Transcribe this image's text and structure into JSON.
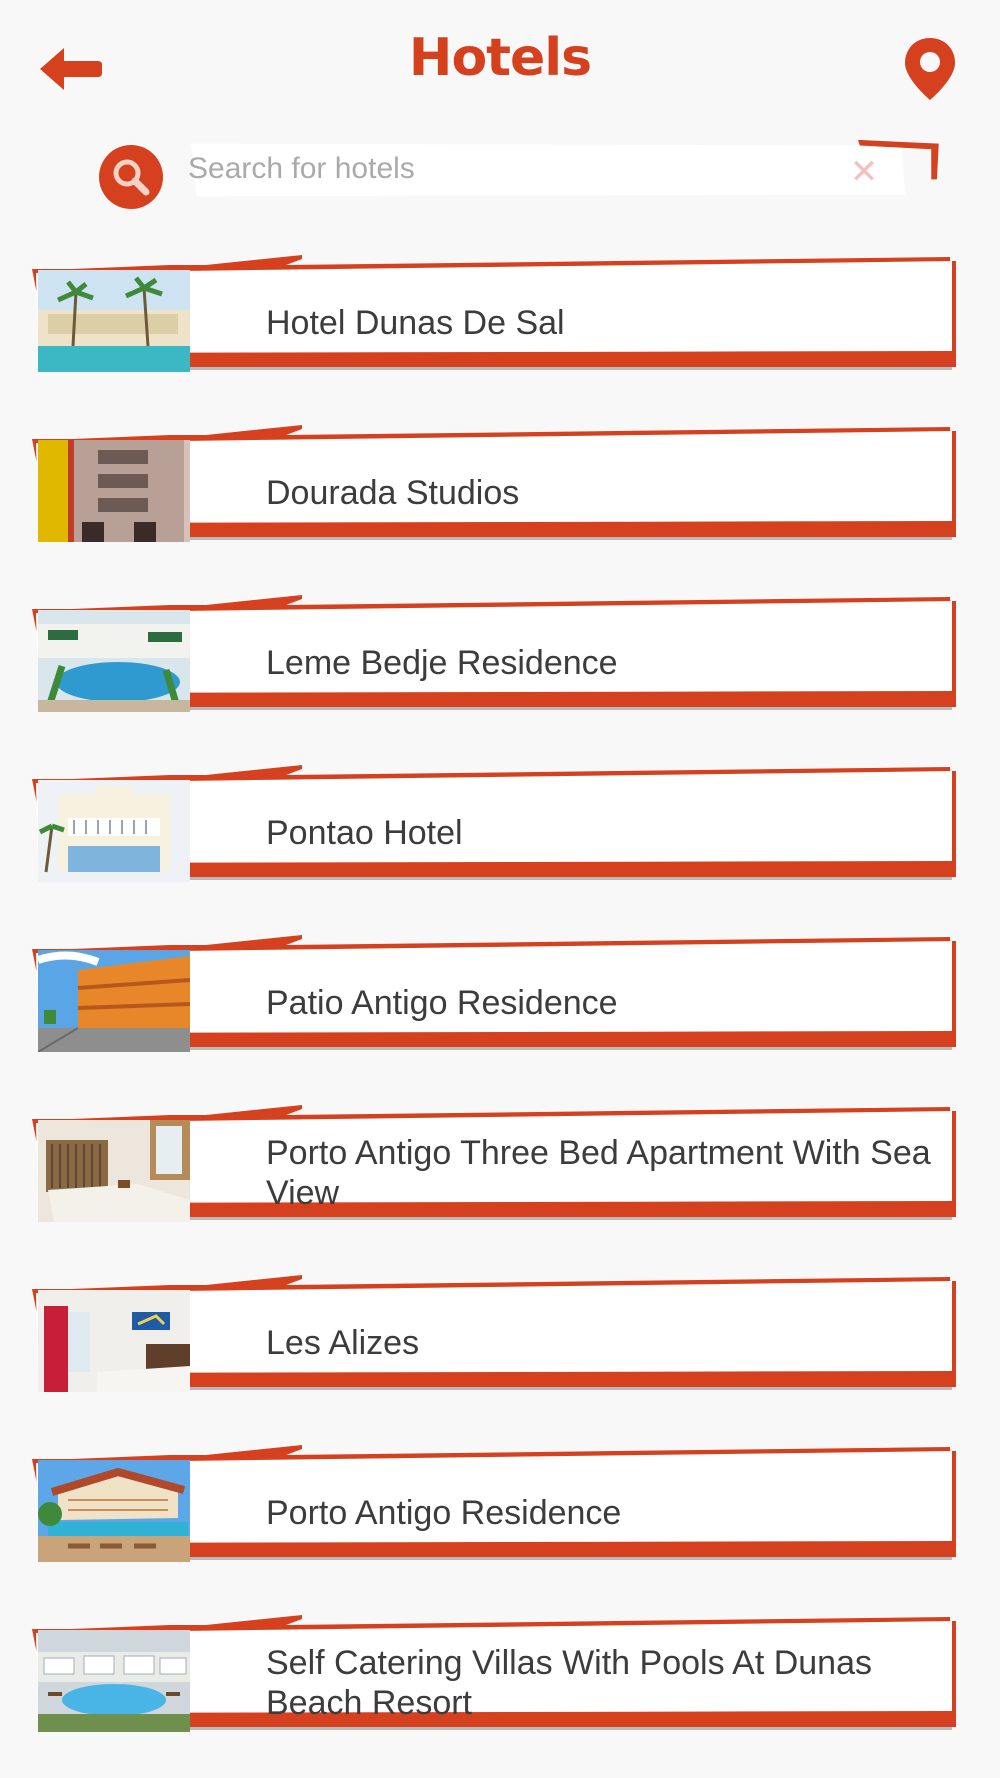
{
  "header": {
    "title": "Hotels",
    "back_icon": "back-arrow-icon",
    "map_icon": "map-pin-icon"
  },
  "search": {
    "placeholder": "Search for hotels",
    "value": "",
    "search_icon": "search-icon",
    "clear_icon": "close-icon"
  },
  "colors": {
    "accent": "#d5401e",
    "background": "#f8f8f8",
    "text": "#3c3c3c"
  },
  "hotels": [
    {
      "name": "Hotel Dunas De Sal",
      "thumb": "pool-palms"
    },
    {
      "name": "Dourada Studios",
      "thumb": "building-facade"
    },
    {
      "name": "Leme Bedje Residence",
      "thumb": "pool-courtyard"
    },
    {
      "name": "Pontao Hotel",
      "thumb": "white-hotel"
    },
    {
      "name": "Patio Antigo Residence",
      "thumb": "street-orange"
    },
    {
      "name": "Porto Antigo Three Bed Apartment With Sea View",
      "thumb": "bedroom-wood"
    },
    {
      "name": "Les Alizes",
      "thumb": "bedroom-red-curtain"
    },
    {
      "name": "Porto Antigo Residence",
      "thumb": "resort-pool"
    },
    {
      "name": "Self Catering Villas With Pools At Dunas Beach Resort",
      "thumb": "villas-aerial"
    }
  ]
}
